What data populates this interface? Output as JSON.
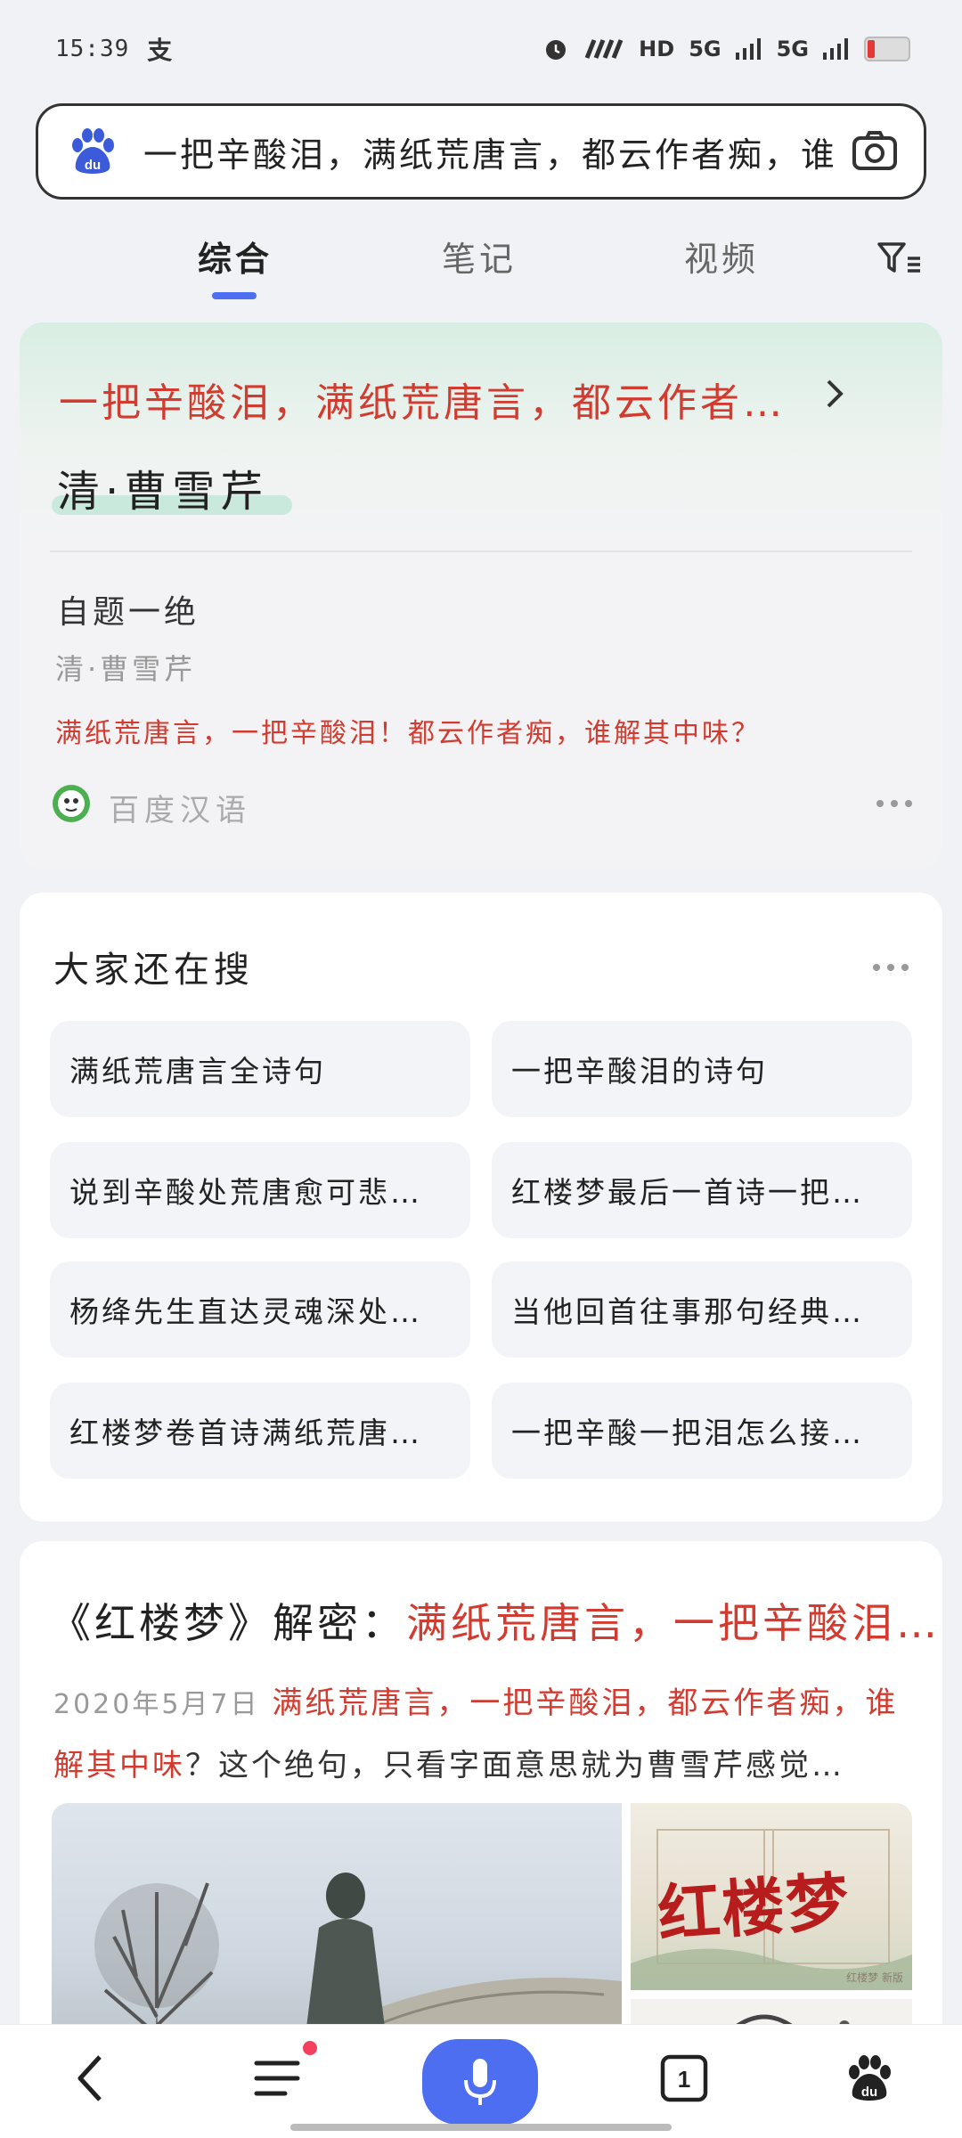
{
  "status_bar": {
    "time": "15:39",
    "alipay_icon": "支",
    "indicators": [
      "alarm-icon",
      "nfc-icon",
      "HD",
      "5G",
      "5G"
    ],
    "hd_label": "HD",
    "net1": "5G",
    "net2": "5G",
    "battery_level": 0.1
  },
  "search": {
    "query": "一把辛酸泪，满纸荒唐言，都云作者痴，谁解其中味？",
    "logo": "du",
    "icons": [
      "baidu-logo-icon",
      "camera-icon"
    ]
  },
  "tabs": [
    {
      "label": "综合",
      "active": true
    },
    {
      "label": "笔记",
      "active": false
    },
    {
      "label": "视频",
      "active": false
    }
  ],
  "card1": {
    "title": "一把辛酸泪，满纸荒唐言，都云作者…",
    "author": "清·曹雪芹",
    "poem_title": "自题一绝",
    "poem_author": "清·曹雪芹",
    "poem_line": "满纸荒唐言，一把辛酸泪！都云作者痴，谁解其中味？",
    "source": "百度汉语",
    "accent_color": "#d23b2f"
  },
  "card2": {
    "title": "大家还在搜",
    "chips": [
      "满纸荒唐言全诗句",
      "一把辛酸泪的诗句",
      "说到辛酸处荒唐愈可悲…",
      "红楼梦最后一首诗一把…",
      "杨绛先生直达灵魂深处…",
      "当他回首往事那句经典…",
      "红楼梦卷首诗满纸荒唐…",
      "一把辛酸一把泪怎么接…"
    ]
  },
  "card3": {
    "title_black": "《红楼梦》解密：",
    "title_red": "满纸荒唐言，一把辛酸泪…",
    "date": "2020年5月7日",
    "snippet_red": "满纸荒唐言，一把辛酸泪，都云作者痴，谁解其中味",
    "snippet_rest": "？这个绝句，只看字面意思就为曹雪芹感觉…",
    "image_text": "红楼梦",
    "image_watermark": "红楼梦 新版"
  },
  "bottom_nav": {
    "items": [
      "back-icon",
      "menu-icon",
      "mic-icon",
      "tabs-icon",
      "baidu-home-icon"
    ],
    "tab_count": "1",
    "accent": "#4e6ef2"
  }
}
